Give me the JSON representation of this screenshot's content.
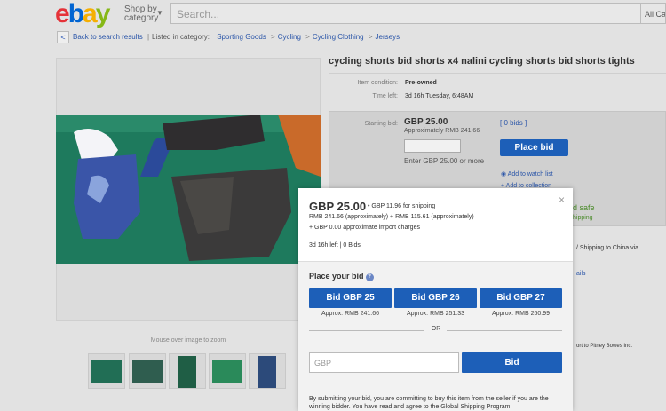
{
  "header": {
    "logo": [
      "e",
      "b",
      "a",
      "y"
    ],
    "logo_colors": [
      "#e53238",
      "#0064d2",
      "#f5af02",
      "#86b817"
    ],
    "shop_by": "Shop by category",
    "search_placeholder": "Search...",
    "all_categories": "All Categories"
  },
  "breadcrumb": {
    "back": "Back to search results",
    "listed_in": "Listed in category:",
    "items": [
      "Sporting Goods",
      "Cycling",
      "Cycling Clothing",
      "Jerseys"
    ]
  },
  "gallery": {
    "mouseover": "Mouse over image to zoom",
    "thumbnail_count": 5
  },
  "item": {
    "title": "cycling shorts bid shorts x4 nalini cycling shorts bid shorts tights",
    "condition_label": "Item condition:",
    "condition_value": "Pre-owned",
    "time_label": "Time left:",
    "time_value": "3d 16h Tuesday, 6:48AM",
    "starting_bid_label": "Starting bid:",
    "starting_bid": "GBP 25.00",
    "approx": "Approximately RMB 241.66",
    "bids_link": "[ 0 bids ]",
    "enter_hint": "Enter GBP 25.00 or more",
    "place_bid": "Place bid",
    "watch": "Add to watch list",
    "collection": "Add to collection",
    "side_safe": "d safe",
    "side_shipping": "hipping",
    "side_china": "/ Shipping to China  via",
    "side_ails": "ails",
    "side_pitney": "ort to Pitney Bowes Inc."
  },
  "modal": {
    "close": "×",
    "price": "GBP 25.00",
    "shipping": "• GBP 11.96 for shipping",
    "line2": "RMB 241.66 (approximately) + RMB 115.61 (approximately)",
    "line3": "+ GBP 0.00 approximate import charges",
    "time": "3d 16h left  |  0 Bids",
    "place_your_bid": "Place your bid",
    "quick_bids": [
      {
        "label": "Bid GBP 25",
        "approx": "Approx.  RMB 241.66"
      },
      {
        "label": "Bid GBP 26",
        "approx": "Approx.  RMB 251.33"
      },
      {
        "label": "Bid GBP 27",
        "approx": "Approx.  RMB 260.99"
      }
    ],
    "or": "OR",
    "input_placeholder": "GBP",
    "bid_button": "Bid",
    "legal": "By submitting your bid, you are committing to buy this item from the seller if you are the winning bidder. You have read and agree to the Global Shipping Program"
  },
  "colors": {
    "accent": "#1d5fb8",
    "link": "#2a55a8",
    "photo_green": "#1e7a5d"
  }
}
